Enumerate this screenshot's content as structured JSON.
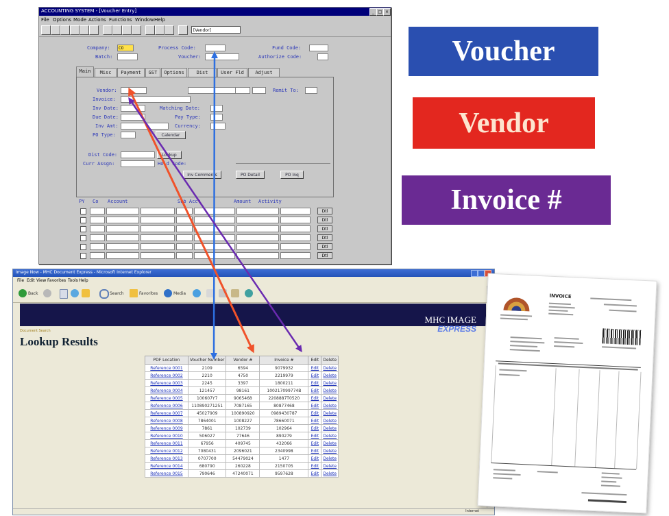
{
  "legacy": {
    "title": "ACCOUNTING SYSTEM - [Voucher Entry]",
    "window_buttons": [
      "_",
      "□",
      "×"
    ],
    "menu": [
      "File",
      "Options",
      "Mode",
      "Actions",
      "Functions",
      "Window",
      "Help"
    ],
    "tool_combo": "[Vendor]",
    "header_fields": [
      {
        "label": "Company:",
        "value": "CO"
      },
      {
        "label": "Batch:",
        "value": ""
      },
      {
        "label": "Process Code:",
        "value": ""
      },
      {
        "label": "Voucher:",
        "value": ""
      },
      {
        "label": "Fund Code:",
        "value": ""
      },
      {
        "label": "Authorize Code:",
        "value": ""
      }
    ],
    "tabs": [
      "Main",
      "Misc",
      "Payment",
      "GST",
      "Options",
      "Dist",
      "User Fld",
      "Adjust"
    ],
    "form_fields": [
      "Vendor:",
      "Invoice:",
      "Inv Date:",
      "Due Date:",
      "Inv Amt:",
      "PO Type:",
      "Dist Code:",
      "Curr Assgn:",
      "Remit To:",
      "Matching Date:",
      "Pay Type:",
      "Currency:",
      "Hold Code:"
    ],
    "buttons": [
      "Inv Comments",
      "PO Detail",
      "PO Inq",
      "Calendar",
      "Lookup"
    ],
    "grid_headers": [
      "PY",
      "Co",
      "Account",
      "Sub Acct",
      "Amount",
      "Activity"
    ],
    "grid_button": "Dtl"
  },
  "labels": {
    "voucher": "Voucher",
    "vendor": "Vendor",
    "invoice": "Invoice #"
  },
  "colors": {
    "voucher": "#2a4fb0",
    "vendor": "#e3271f",
    "invoice": "#6a2a93",
    "voucher_arrow": "#2d6fe0",
    "vendor_arrow": "#f0522a",
    "invoice_arrow": "#6a2ab0"
  },
  "browser": {
    "title": "Image Now - MHC Document Express - Microsoft Internet Explorer",
    "menu": [
      "File",
      "Edit",
      "View",
      "Favorites",
      "Tools",
      "Help"
    ],
    "toolbar": [
      "Back",
      "Search",
      "Favorites",
      "Media"
    ],
    "brand_line1": "MHC IMAGE",
    "brand_line2": "EXPRESS",
    "page_title": "Lookup Results",
    "page_subtitle": "Document Search",
    "status_text": "Internet",
    "table": {
      "headers": [
        "PDF Location",
        "Voucher Number",
        "Vendor #",
        "Invoice #",
        "Edit",
        "Delete"
      ],
      "rows": [
        [
          "Reference 0001",
          "2109",
          "6594",
          "9079932",
          "Edit",
          "Delete"
        ],
        [
          "Reference 0002",
          "2210",
          "4750",
          "2219979",
          "Edit",
          "Delete"
        ],
        [
          "Reference 0003",
          "2245",
          "3397",
          "1800211",
          "Edit",
          "Delete"
        ],
        [
          "Reference 0004",
          "121457",
          "98161",
          "100217099774B",
          "Edit",
          "Delete"
        ],
        [
          "Reference 0005",
          "100607Y7",
          "9065468",
          "2208887T0520",
          "Edit",
          "Delete"
        ],
        [
          "Reference 0006",
          "110890271251",
          "7087165",
          "80877468",
          "Edit",
          "Delete"
        ],
        [
          "Reference 0007",
          "45027909",
          "100890920",
          "0989430787",
          "Edit",
          "Delete"
        ],
        [
          "Reference 0008",
          "7864001",
          "1008227",
          "78660071",
          "Edit",
          "Delete"
        ],
        [
          "Reference 0009",
          "7861",
          "102739",
          "102964",
          "Edit",
          "Delete"
        ],
        [
          "Reference 0010",
          "506027",
          "77646",
          "890279",
          "Edit",
          "Delete"
        ],
        [
          "Reference 0011",
          "67956",
          "409745",
          "432066",
          "Edit",
          "Delete"
        ],
        [
          "Reference 0012",
          "7080431",
          "2096021",
          "2340998",
          "Edit",
          "Delete"
        ],
        [
          "Reference 0013",
          "0707700",
          "54479024",
          "1477",
          "Edit",
          "Delete"
        ],
        [
          "Reference 0014",
          "680790",
          "260228",
          "2150705",
          "Edit",
          "Delete"
        ],
        [
          "Reference 0015",
          "790646",
          "47240071",
          "9597628",
          "Edit",
          "Delete"
        ]
      ]
    }
  },
  "invoice_doc": {
    "heading": "INVOICE"
  }
}
